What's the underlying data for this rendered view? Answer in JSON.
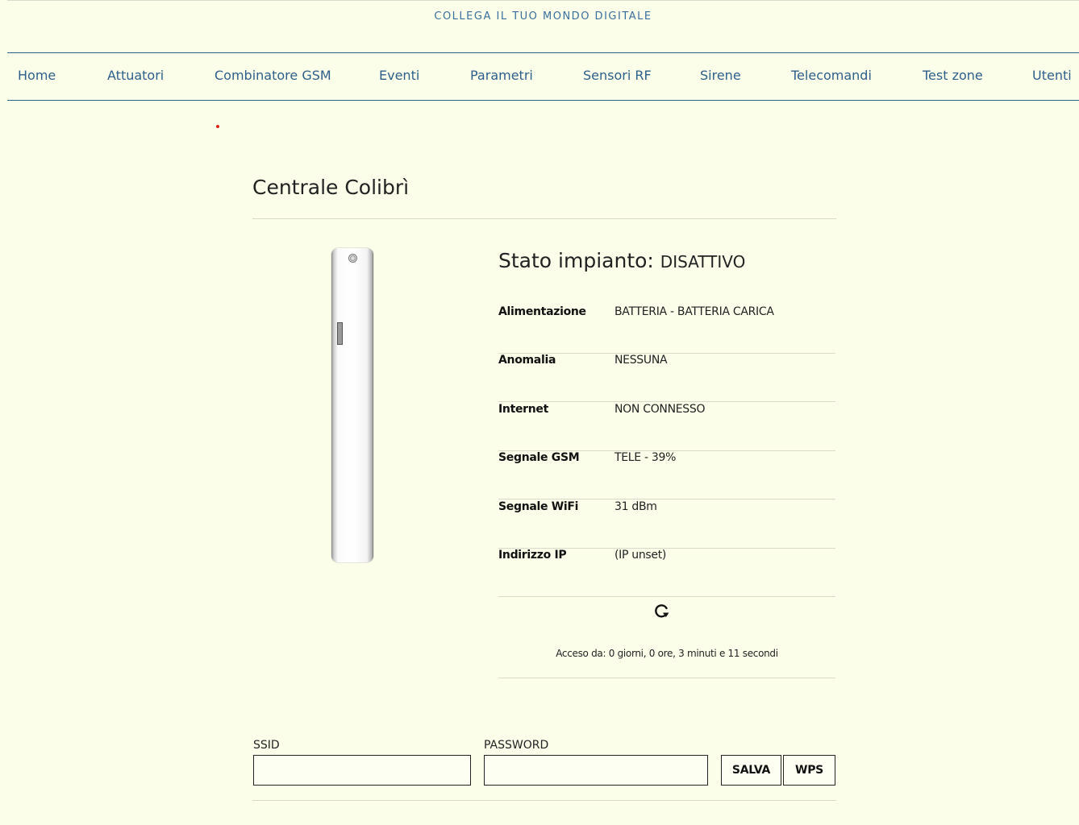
{
  "header": {
    "tagline": "COLLEGA IL TUO MONDO DIGITALE"
  },
  "nav": {
    "items": [
      {
        "label": "Home"
      },
      {
        "label": "Attuatori"
      },
      {
        "label": "Combinatore GSM"
      },
      {
        "label": "Eventi"
      },
      {
        "label": "Parametri"
      },
      {
        "label": "Sensori RF"
      },
      {
        "label": "Sirene"
      },
      {
        "label": "Telecomandi"
      },
      {
        "label": "Test zone"
      },
      {
        "label": "Utenti"
      }
    ]
  },
  "page": {
    "title": "Centrale Colibrì"
  },
  "status": {
    "label": "Stato impianto:",
    "value": "DISATTIVO",
    "rows": [
      {
        "label": "Alimentazione",
        "value": "BATTERIA - BATTERIA CARICA"
      },
      {
        "label": "Anomalia",
        "value": "NESSUNA"
      },
      {
        "label": "Internet",
        "value": "NON CONNESSO"
      },
      {
        "label": "Segnale GSM",
        "value": "TELE - 39%"
      },
      {
        "label": "Segnale WiFi",
        "value": "31 dBm"
      },
      {
        "label": "Indirizzo IP",
        "value": "(IP unset)"
      }
    ],
    "refresh_icon": "refresh-icon",
    "uptime": "Acceso da: 0 giorni, 0 ore, 3 minuti e 11 secondi"
  },
  "wifi_form": {
    "ssid_label": "SSID",
    "ssid_value": "",
    "password_label": "PASSWORD",
    "password_value": "",
    "save_label": "SALVA",
    "wps_label": "WPS"
  },
  "colors": {
    "background": "#fbffea",
    "nav_text": "#2d5f8a",
    "accent_dot": "#e0261b"
  }
}
